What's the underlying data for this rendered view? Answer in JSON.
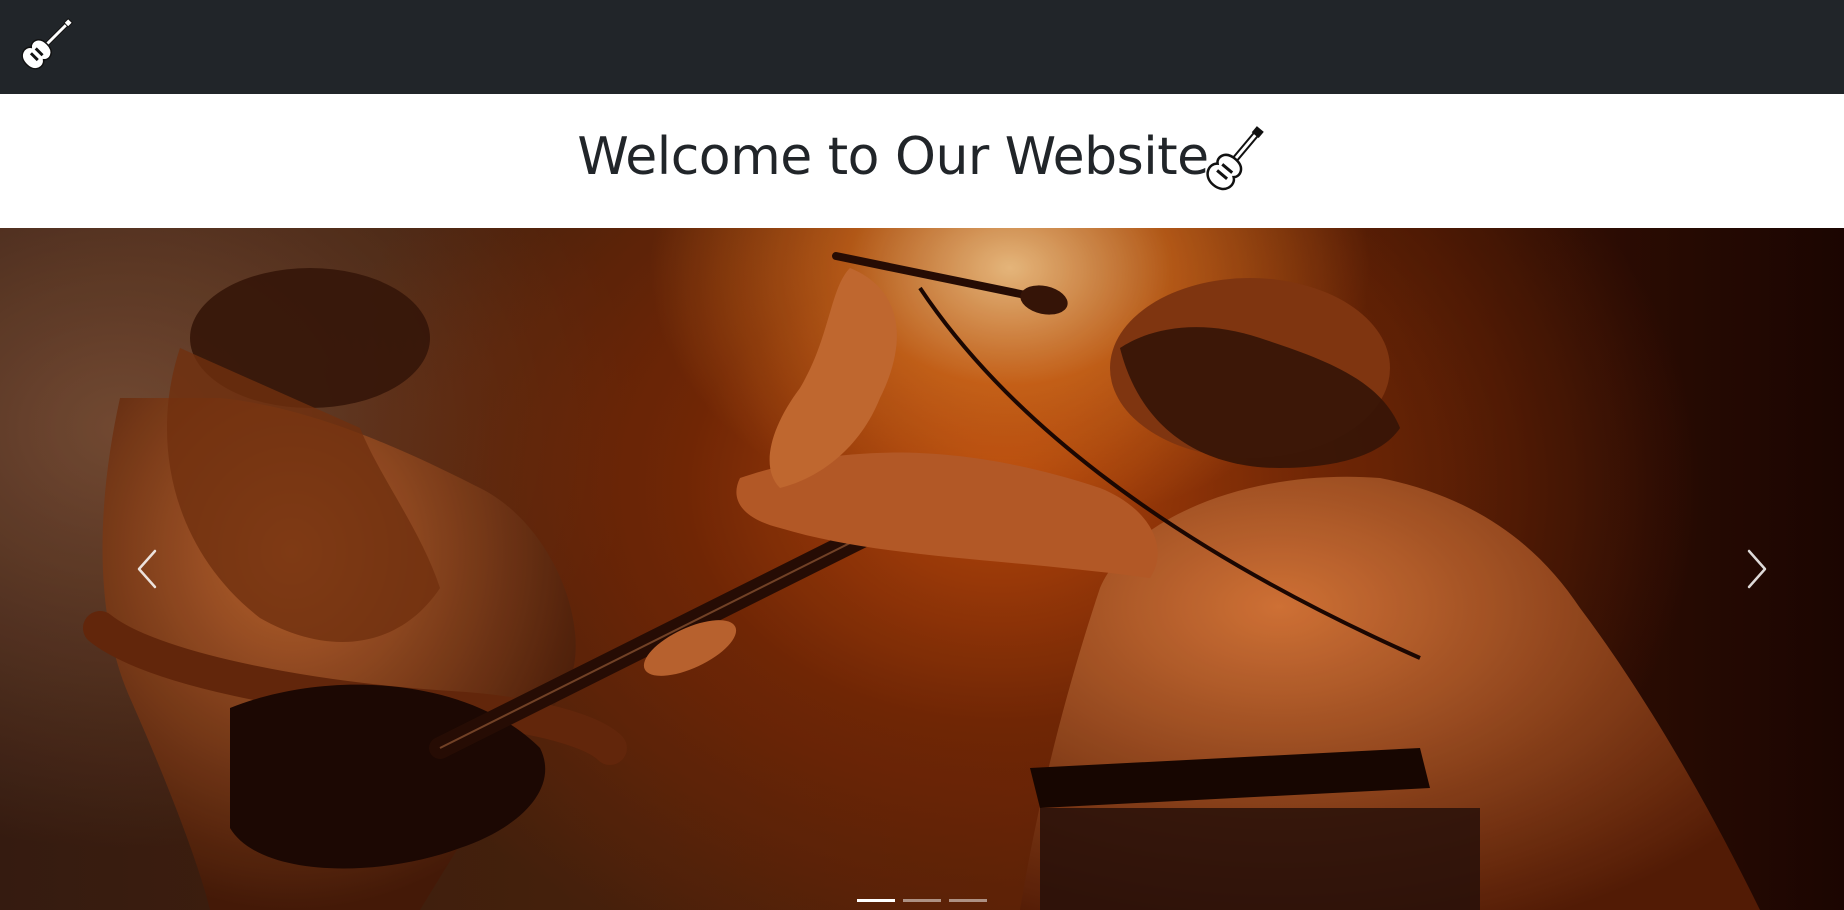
{
  "navbar": {
    "brand_icon": "electric-guitar-icon",
    "background": "#212529"
  },
  "header": {
    "title": "Welcome to Our Website",
    "title_icon": "electric-guitar-icon"
  },
  "carousel": {
    "image_description_icon": "concert-photo",
    "prev_icon": "chevron-left-icon",
    "next_icon": "chevron-right-icon",
    "indicator_count": 3,
    "active_index": 0
  }
}
